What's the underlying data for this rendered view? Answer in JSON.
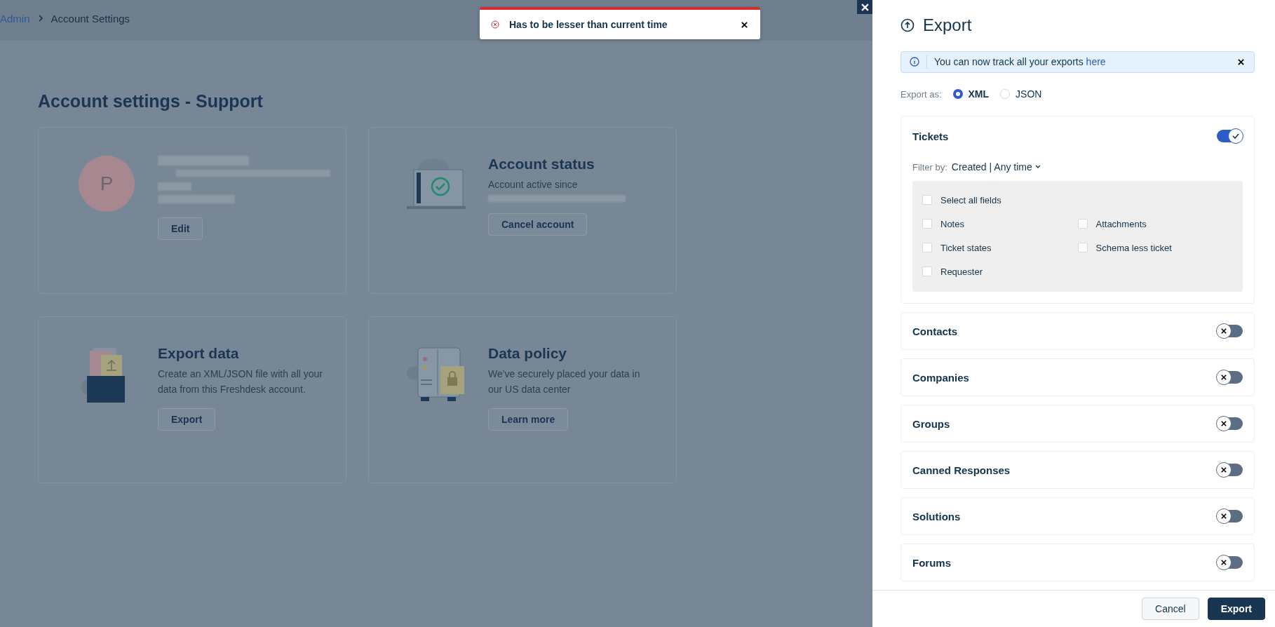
{
  "breadcrumb": [
    {
      "label": "Admin",
      "link": true
    },
    {
      "label": "Account Settings",
      "link": false
    }
  ],
  "toast": {
    "kind": "error",
    "message": "Has to be lesser than current time"
  },
  "page_title": "Account settings - Support",
  "cards": [
    {
      "kind": "profile",
      "avatar": "P",
      "button": "Edit"
    },
    {
      "kind": "status",
      "title": "Account status",
      "description": "Account active since",
      "button": "Cancel account"
    },
    {
      "kind": "export",
      "title": "Export data",
      "description": "Create an XML/JSON file with all your data from this Freshdesk account.",
      "button": "Export"
    },
    {
      "kind": "policy",
      "title": "Data policy",
      "description": "We've securely placed your data in our US data center",
      "button": "Learn more"
    }
  ],
  "export_panel": {
    "title": "Export",
    "info_text": "You can now track all your exports",
    "info_link": "here",
    "format_label": "Export as:",
    "formats": [
      {
        "label": "XML",
        "selected": true
      },
      {
        "label": "JSON",
        "selected": false
      }
    ],
    "sections": [
      {
        "name": "Tickets",
        "on": true,
        "filter_label": "Filter by:",
        "filter_value": "Created | Any time",
        "select_all": {
          "label": "Select all fields",
          "checked": false
        },
        "fields": [
          {
            "label": "Notes",
            "checked": false
          },
          {
            "label": "Attachments",
            "checked": false
          },
          {
            "label": "Ticket states",
            "checked": false
          },
          {
            "label": "Schema less ticket",
            "checked": false
          },
          {
            "label": "Requester",
            "checked": false
          }
        ]
      },
      {
        "name": "Contacts",
        "on": false
      },
      {
        "name": "Companies",
        "on": false
      },
      {
        "name": "Groups",
        "on": false
      },
      {
        "name": "Canned Responses",
        "on": false
      },
      {
        "name": "Solutions",
        "on": false
      },
      {
        "name": "Forums",
        "on": false
      }
    ],
    "buttons": [
      {
        "label": "Cancel",
        "kind": "secondary"
      },
      {
        "label": "Export",
        "kind": "primary"
      }
    ]
  }
}
